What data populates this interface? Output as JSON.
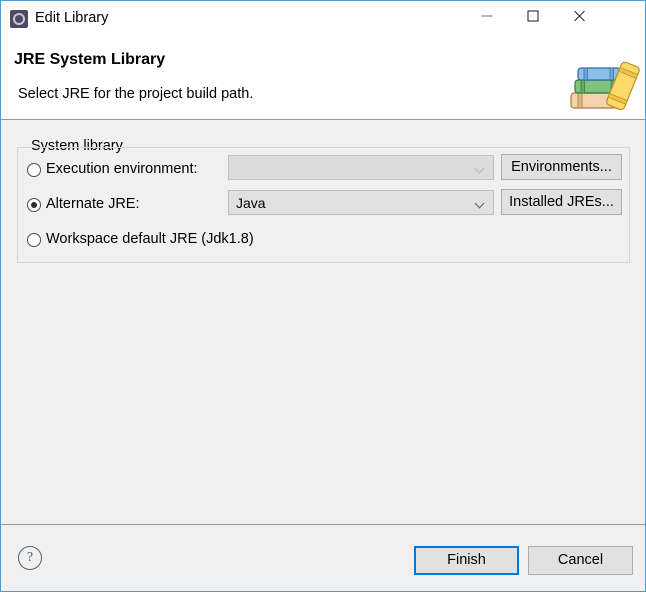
{
  "window": {
    "title": "Edit Library",
    "icon": "library-gear-icon",
    "controls": {
      "minimize": "minimize-icon",
      "maximize": "maximize-icon",
      "close": "close-icon"
    }
  },
  "header": {
    "title": "JRE System Library",
    "description": "Select JRE for the project build path.",
    "banner_icon": "books-stack-icon"
  },
  "group": {
    "label": "System library",
    "options": [
      {
        "id": "execution-environment",
        "label": "Execution environment:",
        "selected": false,
        "combo": {
          "value": "",
          "enabled": false
        },
        "button": "Environments..."
      },
      {
        "id": "alternate-jre",
        "label": "Alternate JRE:",
        "selected": true,
        "combo": {
          "value": "Java",
          "enabled": true
        },
        "button": "Installed JREs..."
      },
      {
        "id": "workspace-default-jre",
        "label": "Workspace default JRE (Jdk1.8)",
        "selected": false
      }
    ]
  },
  "footer": {
    "help_icon": "help-question-icon",
    "finish_label": "Finish",
    "cancel_label": "Cancel"
  },
  "colors": {
    "window_border": "#4a9ad4",
    "focus_blue": "#0078d7",
    "content_bg": "#f0f0f0",
    "header_bg": "#ffffff",
    "button_bg": "#e1e1e1"
  }
}
